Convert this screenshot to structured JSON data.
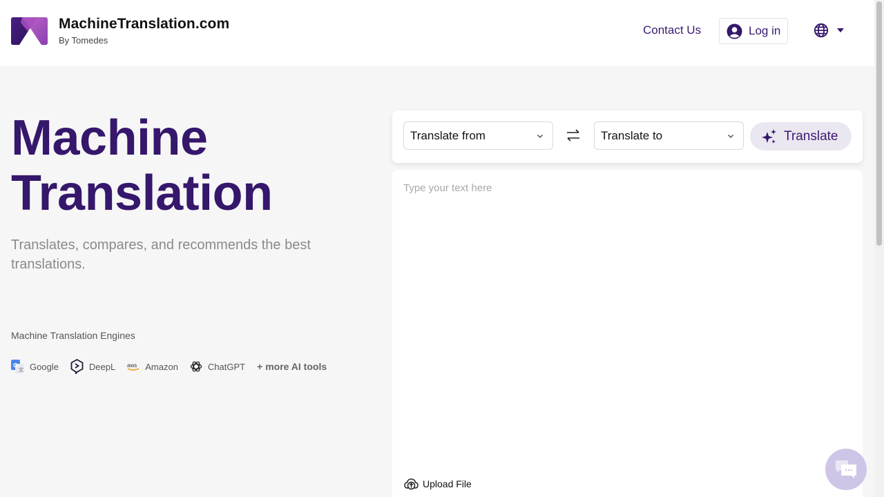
{
  "header": {
    "brand_name": "MachineTranslation.com",
    "brand_sub": "By Tomedes",
    "contact_label": "Contact Us",
    "login_label": "Log in",
    "language_icon": "globe-icon"
  },
  "hero": {
    "title_line1": "Machine",
    "title_line2": "Translation",
    "subtitle": "Translates, compares, and recommends the best translations."
  },
  "engines": {
    "label": "Machine Translation Engines",
    "items": [
      {
        "name": "Google",
        "icon": "google-translate-icon"
      },
      {
        "name": "DeepL",
        "icon": "deepl-icon"
      },
      {
        "name": "Amazon",
        "icon": "aws-icon"
      },
      {
        "name": "ChatGPT",
        "icon": "chatgpt-icon"
      }
    ],
    "more_label": "+ more AI tools"
  },
  "translator": {
    "from_label": "Translate from",
    "to_label": "Translate to",
    "translate_label": "Translate",
    "input_placeholder": "Type your text here",
    "input_value": "",
    "upload_label": "Upload File"
  },
  "colors": {
    "brand": "#35176b",
    "accent_bg": "#ebe7f1",
    "chat_bubble": "#cfc5e6"
  }
}
